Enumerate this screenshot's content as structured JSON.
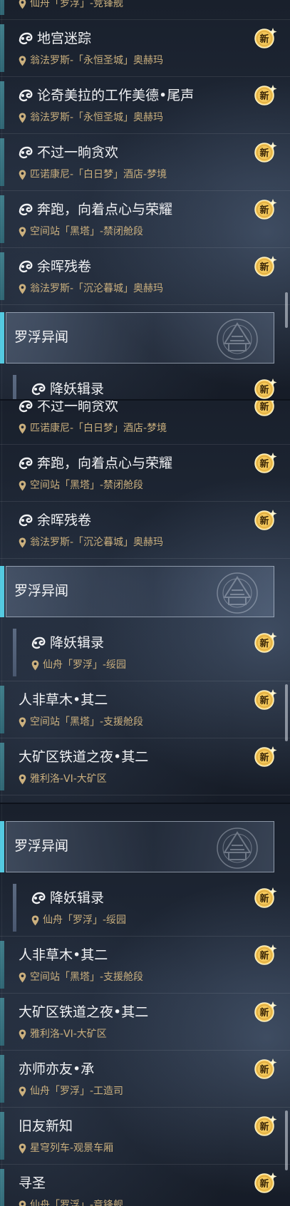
{
  "icons": {
    "quest": "trailblaze-quest-icon",
    "location": "map-pin-icon",
    "new": "new-badge-icon"
  },
  "colors": {
    "accent": "#52c9e0",
    "location_text": "#cbb07e",
    "badge": "#f3c75a"
  },
  "panels": [
    {
      "content_items": [
        {
          "type": "item",
          "title": "",
          "location": "仙舟「罗浮」-竞锋舰",
          "quest_icon": true,
          "accent": true,
          "badge": "新"
        },
        {
          "type": "item",
          "title": "地宫迷踪",
          "location": "翁法罗斯-「永恒圣城」奥赫玛",
          "quest_icon": true,
          "accent": true,
          "badge": "新"
        },
        {
          "type": "item",
          "title": "论奇美拉的工作美德•尾声",
          "location": "翁法罗斯-「永恒圣城」奥赫玛",
          "quest_icon": true,
          "accent": true,
          "badge": "新"
        },
        {
          "type": "item",
          "title": "不过一晌贪欢",
          "location": "匹诺康尼-「白日梦」酒店-梦境",
          "quest_icon": true,
          "accent": true,
          "badge": "新"
        },
        {
          "type": "item",
          "title": "奔跑，向着点心与荣耀",
          "location": "空间站「黑塔」-禁闭舱段",
          "quest_icon": true,
          "accent": true,
          "badge": "新"
        },
        {
          "type": "item",
          "title": "余晖残卷",
          "location": "翁法罗斯-「沉沦暮城」奥赫玛",
          "quest_icon": true,
          "accent": true,
          "badge": "新"
        },
        {
          "type": "category",
          "label": "罗浮异闻"
        },
        {
          "type": "item",
          "sub": true,
          "title": "降妖辑录",
          "location": "",
          "quest_icon": true,
          "accent": true,
          "badge": "新"
        }
      ]
    },
    {
      "content_items": [
        {
          "type": "item",
          "title": "不过一晌贪欢",
          "location": "匹诺康尼-「白日梦」酒店-梦境",
          "quest_icon": true,
          "accent": false,
          "badge": "新"
        },
        {
          "type": "item",
          "title": "奔跑，向着点心与荣耀",
          "location": "空间站「黑塔」-禁闭舱段",
          "quest_icon": true,
          "accent": false,
          "badge": "新"
        },
        {
          "type": "item",
          "title": "余晖残卷",
          "location": "翁法罗斯-「沉沦暮城」奥赫玛",
          "quest_icon": true,
          "accent": false,
          "badge": "新"
        },
        {
          "type": "category",
          "label": "罗浮异闻"
        },
        {
          "type": "item",
          "sub": true,
          "title": "降妖辑录",
          "location": "仙舟「罗浮」-绥园",
          "quest_icon": true,
          "accent": true,
          "badge": "新"
        },
        {
          "type": "item",
          "title": "人非草木•其二",
          "location": "空间站「黑塔」-支援舱段",
          "quest_icon": false,
          "accent": true,
          "badge": "新"
        },
        {
          "type": "item",
          "title": "大矿区铁道之夜•其二",
          "location": "雅利洛-VI-大矿区",
          "quest_icon": false,
          "accent": true,
          "badge": "新"
        }
      ]
    },
    {
      "content_items": [
        {
          "type": "category",
          "label": "罗浮异闻"
        },
        {
          "type": "item",
          "sub": true,
          "title": "降妖辑录",
          "location": "仙舟「罗浮」-绥园",
          "quest_icon": true,
          "accent": true,
          "badge": "新"
        },
        {
          "type": "item",
          "title": "人非草木•其二",
          "location": "空间站「黑塔」-支援舱段",
          "quest_icon": false,
          "accent": true,
          "badge": "新"
        },
        {
          "type": "item",
          "title": "大矿区铁道之夜•其二",
          "location": "雅利洛-VI-大矿区",
          "quest_icon": false,
          "accent": true,
          "badge": "新"
        },
        {
          "type": "item",
          "title": "亦师亦友•承",
          "location": "仙舟「罗浮」-工造司",
          "quest_icon": false,
          "accent": true,
          "badge": "新"
        },
        {
          "type": "item",
          "title": "旧友新知",
          "location": "星穹列车-观景车厢",
          "quest_icon": false,
          "accent": true,
          "badge": "新"
        },
        {
          "type": "item",
          "title": "寻圣",
          "location": "仙舟「罗浮」-竞锋舰",
          "quest_icon": false,
          "accent": true,
          "badge": "新"
        }
      ]
    }
  ]
}
